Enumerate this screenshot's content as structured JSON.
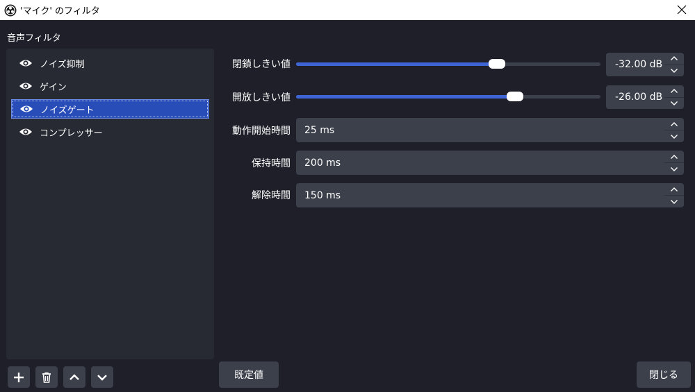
{
  "window": {
    "title": "'マイク' のフィルタ",
    "app_icon": "obs-logo-icon",
    "close_icon": "close-icon"
  },
  "filters_section": {
    "label": "音声フィルタ",
    "items": [
      {
        "name": "ノイズ抑制",
        "visible": true,
        "selected": false
      },
      {
        "name": "ゲイン",
        "visible": true,
        "selected": false
      },
      {
        "name": "ノイズゲート",
        "visible": true,
        "selected": true
      },
      {
        "name": "コンプレッサー",
        "visible": true,
        "selected": false
      }
    ],
    "toolbar_icons": [
      "plus-icon",
      "trash-icon",
      "chevron-up-icon",
      "chevron-down-icon"
    ]
  },
  "settings": {
    "close_threshold": {
      "label": "閉鎖しきい値",
      "value": "-32.00 dB",
      "slider_fraction": 0.66
    },
    "open_threshold": {
      "label": "開放しきい値",
      "value": "-26.00 dB",
      "slider_fraction": 0.72
    },
    "attack_time": {
      "label": "動作開始時間",
      "value": "25 ms"
    },
    "hold_time": {
      "label": "保持時間",
      "value": "200 ms"
    },
    "release_time": {
      "label": "解除時間",
      "value": "150 ms"
    }
  },
  "buttons": {
    "defaults": "既定値",
    "close": "閉じる"
  },
  "colors": {
    "background": "#1e1f29",
    "panel": "#272a33",
    "control": "#3c404b",
    "accent": "#3f65d4",
    "selection": "#284cb8"
  }
}
